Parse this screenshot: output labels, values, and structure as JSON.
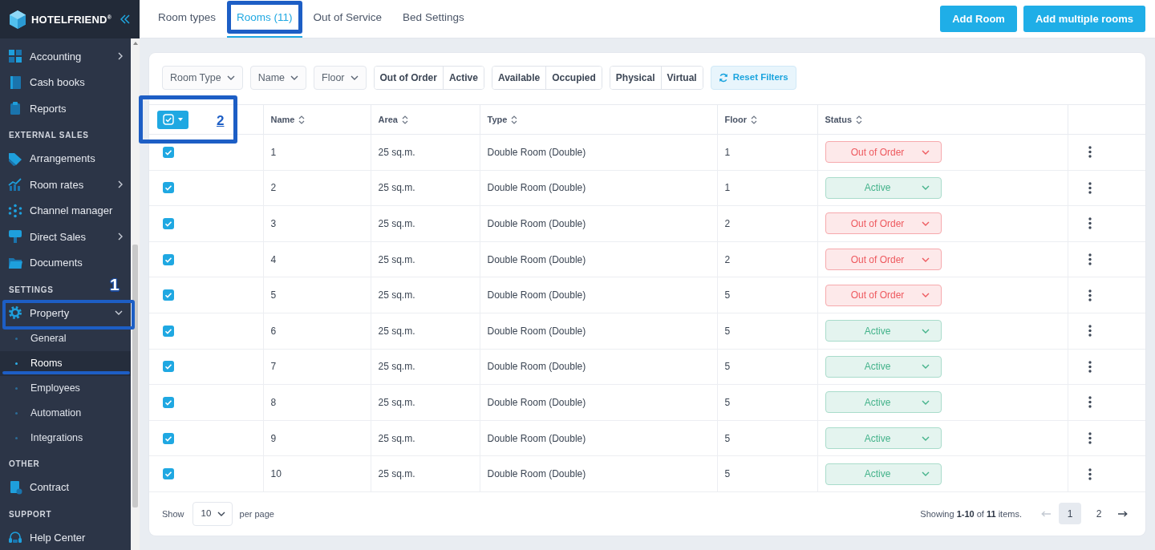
{
  "sidebar": {
    "brand": "HOTELFRIEND$^{®}$",
    "sections": [
      {
        "items": [
          {
            "label": "Accounting",
            "expanded": false
          },
          {
            "label": "Cash books"
          },
          {
            "label": "Reports"
          }
        ]
      },
      {
        "heading": "EXTERNAL SALES",
        "items": [
          {
            "label": "Arrangements"
          },
          {
            "label": "Room rates",
            "expanded": false
          },
          {
            "label": "Channel manager"
          },
          {
            "label": "Direct Sales",
            "expanded": false
          },
          {
            "label": "Documents"
          }
        ]
      },
      {
        "heading": "SETTINGS",
        "items": [
          {
            "label": "Property",
            "expanded": true,
            "callout": "1",
            "children": [
              {
                "label": "General",
                "selected": false,
                "underlined": false
              },
              {
                "label": "Rooms",
                "selected": true,
                "underlined": true
              },
              {
                "label": "Employees",
                "selected": false,
                "underlined": false
              },
              {
                "label": "Automation",
                "selected": false,
                "underlined": false
              },
              {
                "label": "Integrations",
                "selected": false,
                "underlined": false
              }
            ]
          }
        ]
      },
      {
        "heading": "OTHER",
        "items": [
          {
            "label": "Contract"
          }
        ]
      },
      {
        "heading": "SUPPORT",
        "items": [
          {
            "label": "Help Center"
          }
        ]
      }
    ]
  },
  "tabs": [
    {
      "label": "Room types",
      "selected": false,
      "framed": false
    },
    {
      "label": "Rooms (11)",
      "selected": true,
      "framed": true
    },
    {
      "label": "Out of Service",
      "selected": false,
      "framed": false
    },
    {
      "label": "Bed Settings",
      "selected": false,
      "framed": false
    }
  ],
  "actions": [
    "Add Room",
    "Add multiple rooms"
  ],
  "filters": [
    {
      "kind": "dropdown",
      "label": "Room Type"
    },
    {
      "kind": "dropdown",
      "label": "Name"
    },
    {
      "kind": "dropdown",
      "label": "Floor"
    },
    {
      "kind": "toggle_group",
      "options": [
        {
          "label": "Out of Order",
          "selected": false
        },
        {
          "label": "Active",
          "selected": false
        }
      ]
    },
    {
      "kind": "toggle_group",
      "options": [
        {
          "label": "Available",
          "selected": false
        },
        {
          "label": "Occupied",
          "selected": false
        }
      ]
    },
    {
      "kind": "toggle_group",
      "options": [
        {
          "label": "Physical",
          "selected": false
        },
        {
          "label": "Virtual",
          "selected": false
        }
      ]
    },
    {
      "kind": "reset",
      "label": "Reset Filters"
    }
  ],
  "table": {
    "select_all": {
      "checked": true,
      "callout": "2"
    },
    "columns": [
      "Name",
      "Area",
      "Type",
      "Floor",
      "Status"
    ],
    "rows": [
      {
        "checked": true,
        "cells": [
          "1",
          "25 sq.m.",
          "Double Room (Double)",
          "1"
        ],
        "status": {
          "label": "Out of Order",
          "kind": "out_of_order"
        }
      },
      {
        "checked": true,
        "cells": [
          "2",
          "25 sq.m.",
          "Double Room (Double)",
          "1"
        ],
        "status": {
          "label": "Active",
          "kind": "active"
        }
      },
      {
        "checked": true,
        "cells": [
          "3",
          "25 sq.m.",
          "Double Room (Double)",
          "2"
        ],
        "status": {
          "label": "Out of Order",
          "kind": "out_of_order"
        }
      },
      {
        "checked": true,
        "cells": [
          "4",
          "25 sq.m.",
          "Double Room (Double)",
          "2"
        ],
        "status": {
          "label": "Out of Order",
          "kind": "out_of_order"
        }
      },
      {
        "checked": true,
        "cells": [
          "5",
          "25 sq.m.",
          "Double Room (Double)",
          "5"
        ],
        "status": {
          "label": "Out of Order",
          "kind": "out_of_order"
        }
      },
      {
        "checked": true,
        "cells": [
          "6",
          "25 sq.m.",
          "Double Room (Double)",
          "5"
        ],
        "status": {
          "label": "Active",
          "kind": "active"
        }
      },
      {
        "checked": true,
        "cells": [
          "7",
          "25 sq.m.",
          "Double Room (Double)",
          "5"
        ],
        "status": {
          "label": "Active",
          "kind": "active"
        }
      },
      {
        "checked": true,
        "cells": [
          "8",
          "25 sq.m.",
          "Double Room (Double)",
          "5"
        ],
        "status": {
          "label": "Active",
          "kind": "active"
        }
      },
      {
        "checked": true,
        "cells": [
          "9",
          "25 sq.m.",
          "Double Room (Double)",
          "5"
        ],
        "status": {
          "label": "Active",
          "kind": "active"
        }
      },
      {
        "checked": true,
        "cells": [
          "10",
          "25 sq.m.",
          "Double Room (Double)",
          "5"
        ],
        "status": {
          "label": "Active",
          "kind": "active"
        }
      }
    ]
  },
  "footer": {
    "show_label": "Show",
    "page_size": "10",
    "per_page_label": "per page",
    "summary": "Showing **1-10** of **11** items.",
    "prev": {
      "disabled": true
    },
    "pages": [
      {
        "label": "1",
        "selected": true
      },
      {
        "label": "2",
        "selected": false
      }
    ],
    "next": {
      "disabled": false
    }
  }
}
